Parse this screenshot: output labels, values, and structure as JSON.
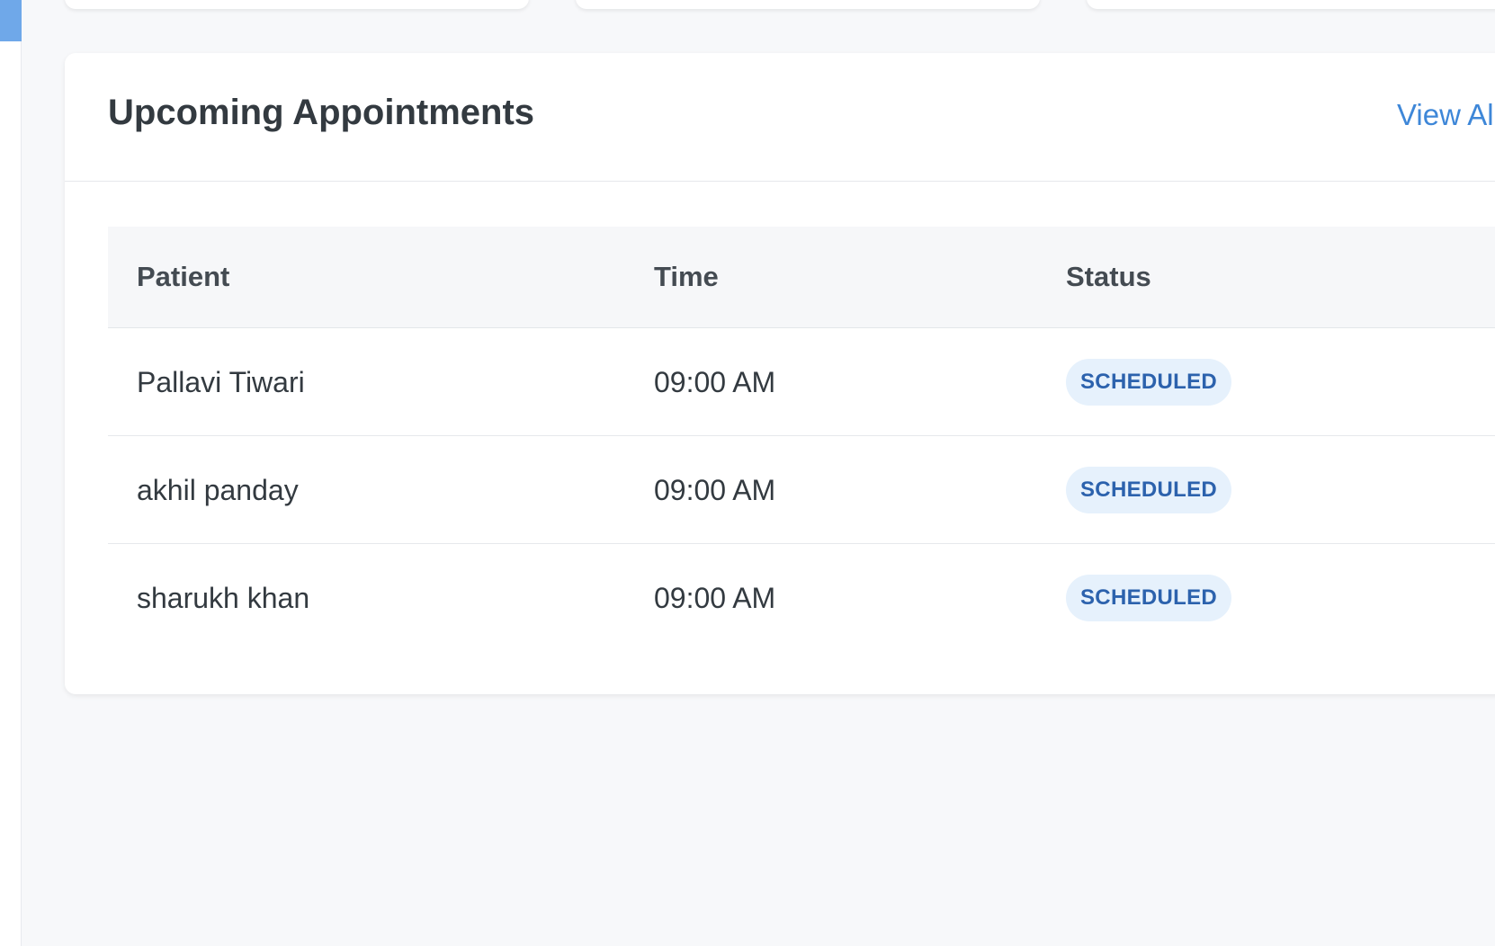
{
  "appointments_card": {
    "title": "Upcoming Appointments",
    "view_all_label": "View All"
  },
  "table": {
    "headers": {
      "patient": "Patient",
      "time": "Time",
      "status": "Status"
    },
    "rows": [
      {
        "patient": "Pallavi Tiwari",
        "time": "09:00 AM",
        "status": "SCHEDULED"
      },
      {
        "patient": "akhil panday",
        "time": "09:00 AM",
        "status": "SCHEDULED"
      },
      {
        "patient": "sharukh khan",
        "time": "09:00 AM",
        "status": "SCHEDULED"
      }
    ]
  },
  "colors": {
    "accent": "#3e87d8",
    "badge_bg": "#e6f1fc",
    "badge_text": "#2c62ad",
    "page_bg": "#f7f8fa"
  }
}
